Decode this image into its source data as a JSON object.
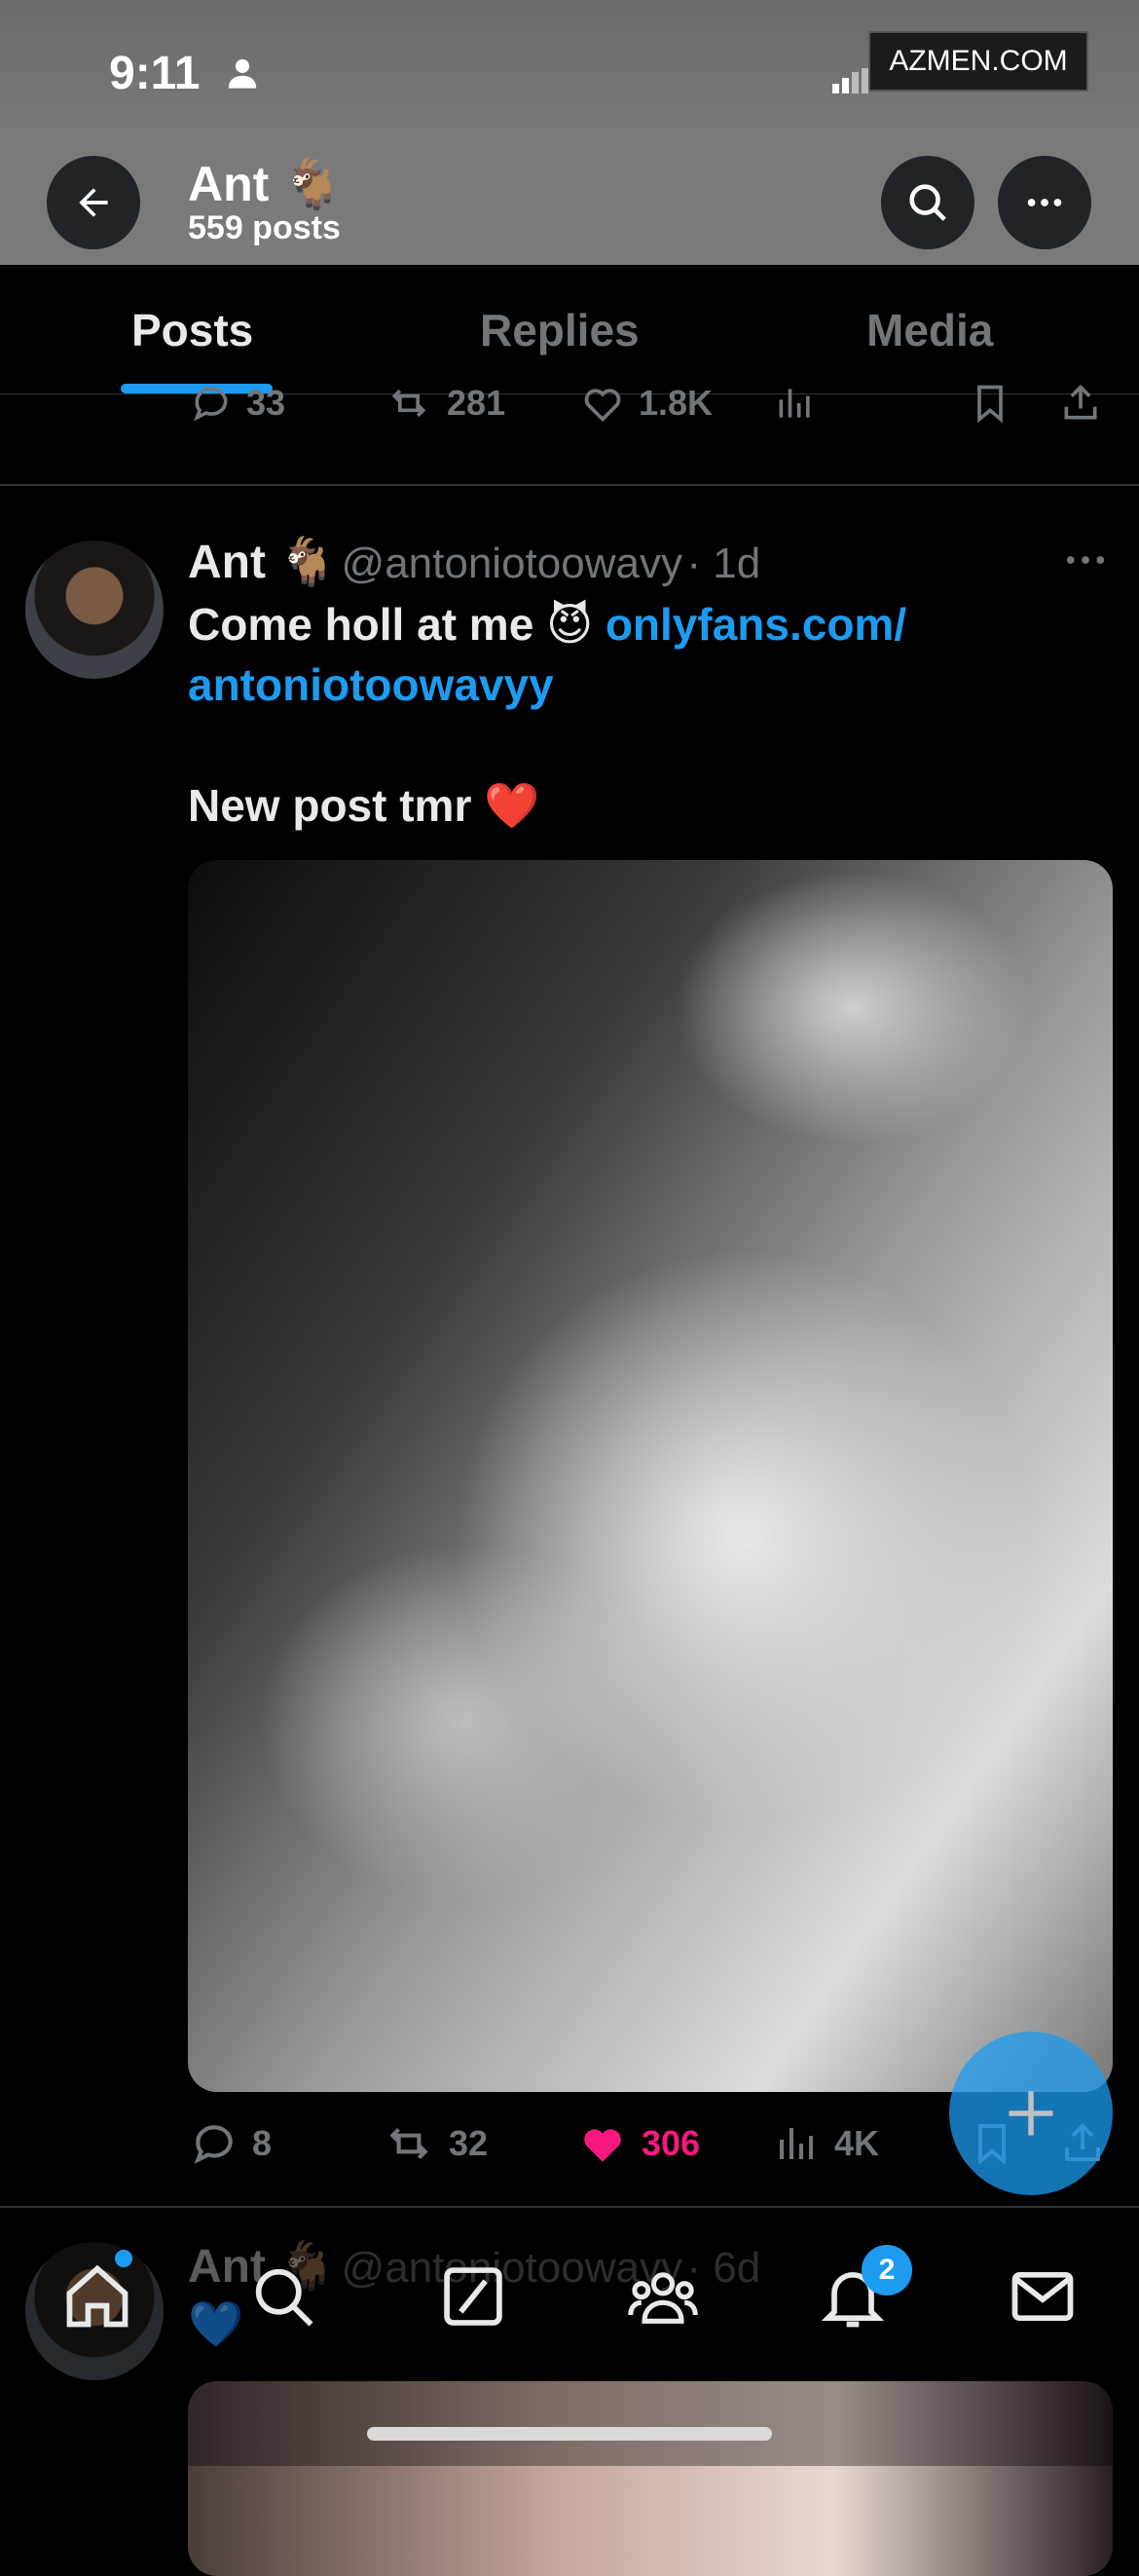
{
  "status_bar": {
    "time": "9:11",
    "watermark": "AZMEN.COM"
  },
  "header": {
    "profile_name": "Ant 🐐",
    "post_count": "559 posts"
  },
  "tabs": [
    {
      "label": "Posts"
    },
    {
      "label": "Replies"
    },
    {
      "label": "Media"
    }
  ],
  "prev_tweet": {
    "replies": "33",
    "reposts": "281",
    "likes": "1.8K"
  },
  "tweet": {
    "name": "Ant 🐐",
    "handle": "@antoniotoowavy",
    "time": "· 1d",
    "text_line1": "Come holl at me 😈 ",
    "link_part1": "onlyfans.com/",
    "link_part2": "antoniotoowavyy",
    "text_line3": "New post tmr ❤️",
    "replies": "8",
    "reposts": "32",
    "likes": "306",
    "views": "4K"
  },
  "next_tweet": {
    "name": "Ant 🐐",
    "handle": "@antoniotoowavy",
    "time": "· 6d",
    "text": "💙"
  },
  "nav": {
    "notifications_badge": "2"
  },
  "colors": {
    "accent": "#1d9bf0",
    "like": "#f91880",
    "muted": "#71767b"
  }
}
